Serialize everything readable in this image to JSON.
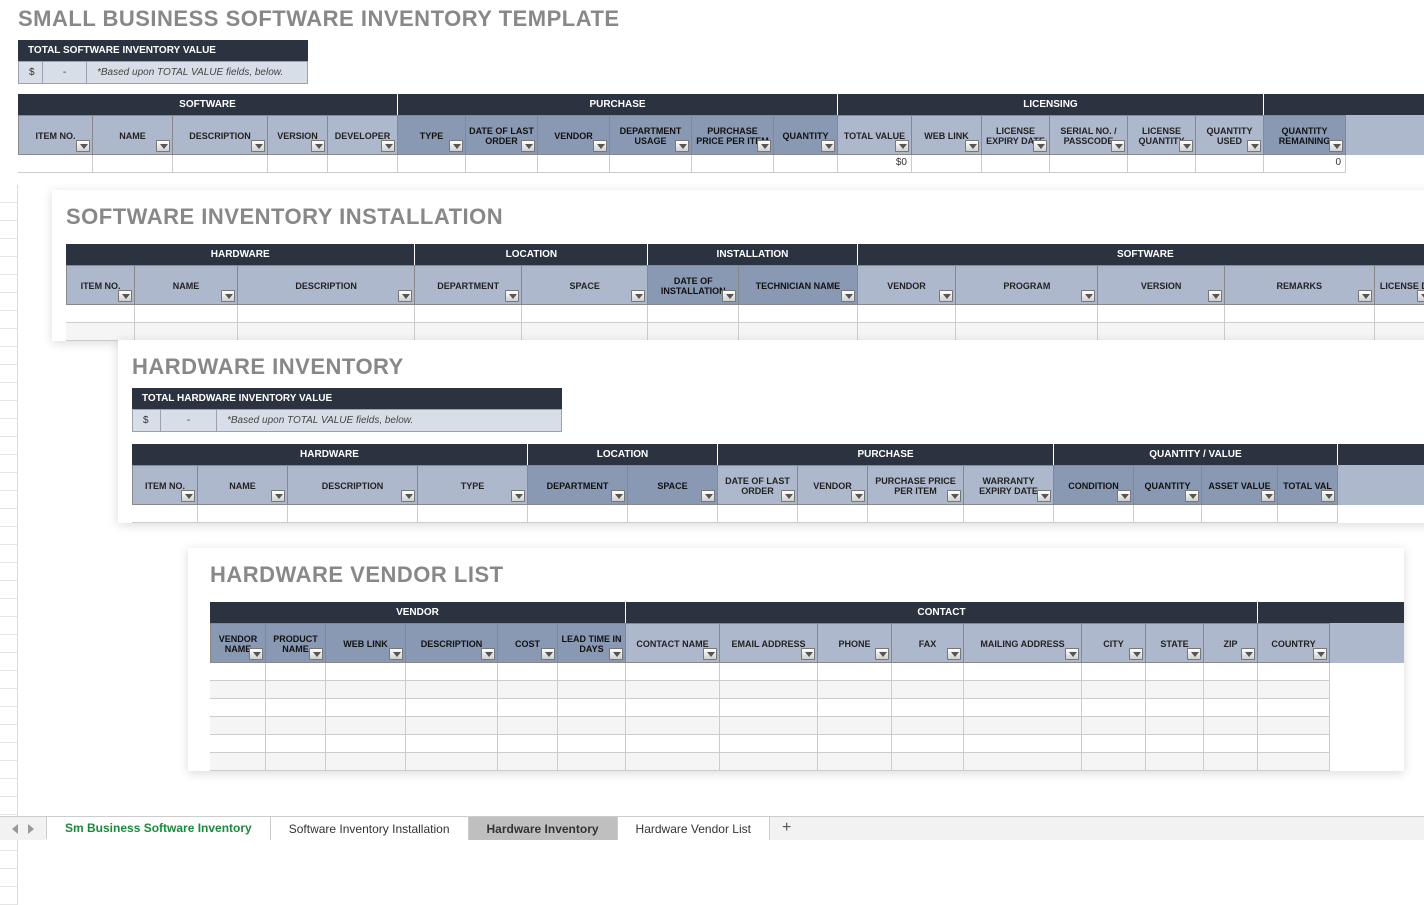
{
  "sheet1": {
    "title": "SMALL BUSINESS SOFTWARE INVENTORY TEMPLATE",
    "totalBox": {
      "header": "TOTAL SOFTWARE INVENTORY VALUE",
      "currency": "$",
      "value": "-",
      "note": "*Based upon TOTAL VALUE fields, below."
    },
    "categories": [
      {
        "label": "SOFTWARE",
        "span": 5
      },
      {
        "label": "PURCHASE",
        "span": 6
      },
      {
        "label": "LICENSING",
        "span": 6
      }
    ],
    "headers": [
      "ITEM NO.",
      "NAME",
      "DESCRIPTION",
      "VERSION",
      "DEVELOPER",
      "TYPE",
      "DATE OF LAST ORDER",
      "VENDOR",
      "DEPARTMENT USAGE",
      "PURCHASE PRICE PER ITEM",
      "QUANTITY",
      "TOTAL VALUE",
      "WEB LINK",
      "LICENSE EXPIRY DATE",
      "SERIAL NO. / PASSCODE",
      "LICENSE QUANTITY",
      "QUANTITY USED",
      "QUANTITY REMAINING"
    ],
    "row1": {
      "totalValue": "$0",
      "qtyRemaining": "0"
    }
  },
  "sheet2": {
    "title": "SOFTWARE INVENTORY INSTALLATION",
    "categories": [
      {
        "label": "HARDWARE",
        "span": 3
      },
      {
        "label": "LOCATION",
        "span": 2
      },
      {
        "label": "INSTALLATION",
        "span": 2
      },
      {
        "label": "SOFTWARE",
        "span": 5
      }
    ],
    "headers": [
      "ITEM NO.",
      "NAME",
      "DESCRIPTION",
      "DEPARTMENT",
      "SPACE",
      "DATE OF INSTALLATION",
      "TECHNICIAN NAME",
      "VENDOR",
      "PROGRAM",
      "VERSION",
      "REMARKS",
      "LICENSE D"
    ]
  },
  "sheet3": {
    "title": "HARDWARE INVENTORY",
    "totalBox": {
      "header": "TOTAL HARDWARE INVENTORY VALUE",
      "currency": "$",
      "value": "-",
      "note": "*Based upon TOTAL VALUE fields, below."
    },
    "categories": [
      {
        "label": "HARDWARE",
        "span": 4
      },
      {
        "label": "LOCATION",
        "span": 2
      },
      {
        "label": "PURCHASE",
        "span": 4
      },
      {
        "label": "QUANTITY / VALUE",
        "span": 4
      }
    ],
    "headers": [
      "ITEM NO.",
      "NAME",
      "DESCRIPTION",
      "TYPE",
      "DEPARTMENT",
      "SPACE",
      "DATE OF LAST ORDER",
      "VENDOR",
      "PURCHASE PRICE PER ITEM",
      "WARRANTY EXPIRY DATE",
      "CONDITION",
      "QUANTITY",
      "ASSET VALUE",
      "TOTAL VAL"
    ]
  },
  "sheet4": {
    "title": "HARDWARE VENDOR LIST",
    "categories": [
      {
        "label": "VENDOR",
        "span": 6
      },
      {
        "label": "CONTACT",
        "span": 8
      }
    ],
    "headers": [
      "VENDOR NAME",
      "PRODUCT NAME",
      "WEB LINK",
      "DESCRIPTION",
      "COST",
      "LEAD TIME IN DAYS",
      "CONTACT NAME",
      "EMAIL ADDRESS",
      "PHONE",
      "FAX",
      "MAILING ADDRESS",
      "CITY",
      "STATE",
      "ZIP",
      "COUNTRY"
    ]
  },
  "tabs": {
    "t1": "Sm Business Software Inventory",
    "t2": "Software Inventory Installation",
    "t3": "Hardware Inventory",
    "t4": "Hardware Vendor List"
  }
}
